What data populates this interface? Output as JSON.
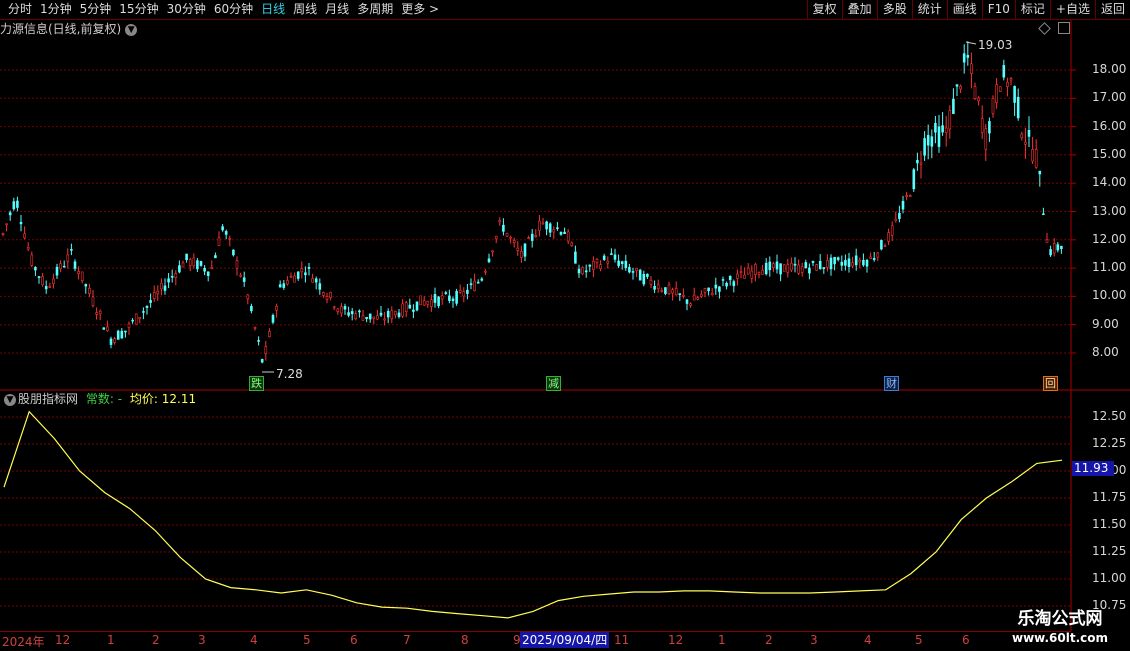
{
  "toolbar": {
    "periods": [
      "分时",
      "1分钟",
      "5分钟",
      "15分钟",
      "30分钟",
      "60分钟",
      "日线",
      "周线",
      "月线",
      "多周期",
      "更多 >"
    ],
    "active_index": 6,
    "buttons": [
      "复权",
      "叠加",
      "多股",
      "统计",
      "画线",
      "F10",
      "标记",
      "+自选",
      "返回"
    ]
  },
  "main_panel": {
    "title": "力源信息(日线,前复权)",
    "high_label": "19.03",
    "low_label": "7.28",
    "y_ticks": [
      "18.00",
      "17.00",
      "16.00",
      "15.00",
      "14.00",
      "13.00",
      "12.00",
      "11.00",
      "10.00",
      "9.00",
      "8.00"
    ],
    "markers": [
      {
        "text": "跌",
        "color": "#2db52d"
      },
      {
        "text": "减",
        "color": "#2db52d"
      },
      {
        "text": "财",
        "color": "#3a7fd5"
      },
      {
        "text": "回",
        "color": "#e06c1c"
      }
    ]
  },
  "indicator_panel": {
    "name": "股朋指标网",
    "param_label": "常数: -",
    "avg_label": "均价: 12.11",
    "current_value": "11.93",
    "y_ticks": [
      "12.50",
      "12.25",
      "12.00",
      "11.75",
      "11.50",
      "11.25",
      "11.00",
      "10.75"
    ]
  },
  "x_axis": {
    "labels": [
      "2024年",
      "12",
      "1",
      "2",
      "3",
      "4",
      "5",
      "6",
      "7",
      "8",
      "9",
      "11",
      "12",
      "1",
      "2",
      "3",
      "4",
      "5",
      "6"
    ],
    "cursor_date": "2025/09/04/四"
  },
  "watermark": {
    "line1": "乐淘公式网",
    "line2": "www.60lt.com"
  },
  "colors": {
    "up": "#ff3232",
    "down": "#54ffff",
    "line": "#ffff54",
    "grid": "#7a0000"
  },
  "chart_data": {
    "type": "line",
    "series": [
      {
        "values": [
          11.85,
          12.55,
          12.3,
          12.0,
          11.8,
          11.65,
          11.45,
          11.2,
          11.0,
          10.92,
          10.9,
          10.87,
          10.9,
          10.85,
          10.78,
          10.74,
          10.73,
          10.7,
          10.68,
          10.66,
          10.64,
          10.7,
          10.8,
          10.84,
          10.86,
          10.88,
          10.88,
          10.89,
          10.89,
          10.88,
          10.87,
          10.87,
          10.87,
          10.88,
          10.89,
          10.9,
          11.05,
          11.25,
          11.55,
          11.75,
          11.9,
          12.07,
          12.1
        ]
      }
    ],
    "ylim": [
      10.7,
      12.65
    ]
  }
}
